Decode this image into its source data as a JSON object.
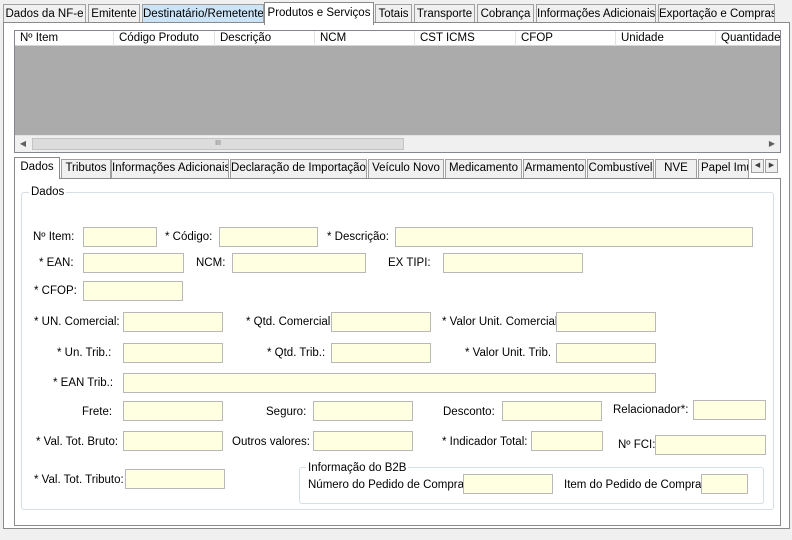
{
  "top_tabs": [
    "Dados da NF-e",
    "Emitente",
    "Destinatário/Remetente",
    "Produtos e Serviços",
    "Totais",
    "Transporte",
    "Cobrança",
    "Informações Adicionais",
    "Exportação e Compras"
  ],
  "grid_columns": [
    "Nº Item",
    "Código Produto",
    "Descrição",
    "NCM",
    "CST ICMS",
    "CFOP",
    "Unidade",
    "Quantidade"
  ],
  "grid_scroll": {
    "thumb_grip": "III"
  },
  "sub_tabs": [
    "Dados",
    "Tributos",
    "Informações Adicionais",
    "Declaração de Importação",
    "Veículo Novo",
    "Medicamento",
    "Armamento",
    "Combustível",
    "NVE",
    "Papel Imu"
  ],
  "dados": {
    "legend": "Dados",
    "labels": {
      "n_item": "Nº Item:",
      "codigo": "* Código:",
      "descricao": "* Descrição:",
      "ean": "* EAN:",
      "ncm": "NCM:",
      "ex_tipi": "EX TIPI:",
      "cfop": "* CFOP:",
      "un_comercial": "* UN. Comercial:",
      "qtd_comercial": "* Qtd. Comercial:",
      "valor_unit_comercial": "* Valor Unit. Comercial:",
      "un_trib": "* Un. Trib.:",
      "qtd_trib": "* Qtd. Trib.:",
      "valor_unit_trib": "* Valor Unit. Trib.",
      "ean_trib": "* EAN Trib.:",
      "frete": "Frete:",
      "seguro": "Seguro:",
      "desconto": "Desconto:",
      "relacionador": "Relacionador*:",
      "val_tot_bruto": "* Val. Tot. Bruto:",
      "outros_valores": "Outros valores:",
      "indicador_total": "* Indicador Total:",
      "n_fci": "Nº FCI:",
      "val_tot_tributo": "* Val. Tot. Tributo:"
    },
    "b2b": {
      "legend": "Informação do B2B",
      "numero_pedido": "Número do Pedido de Compra:",
      "item_pedido": "Item do Pedido de Compra:"
    }
  }
}
